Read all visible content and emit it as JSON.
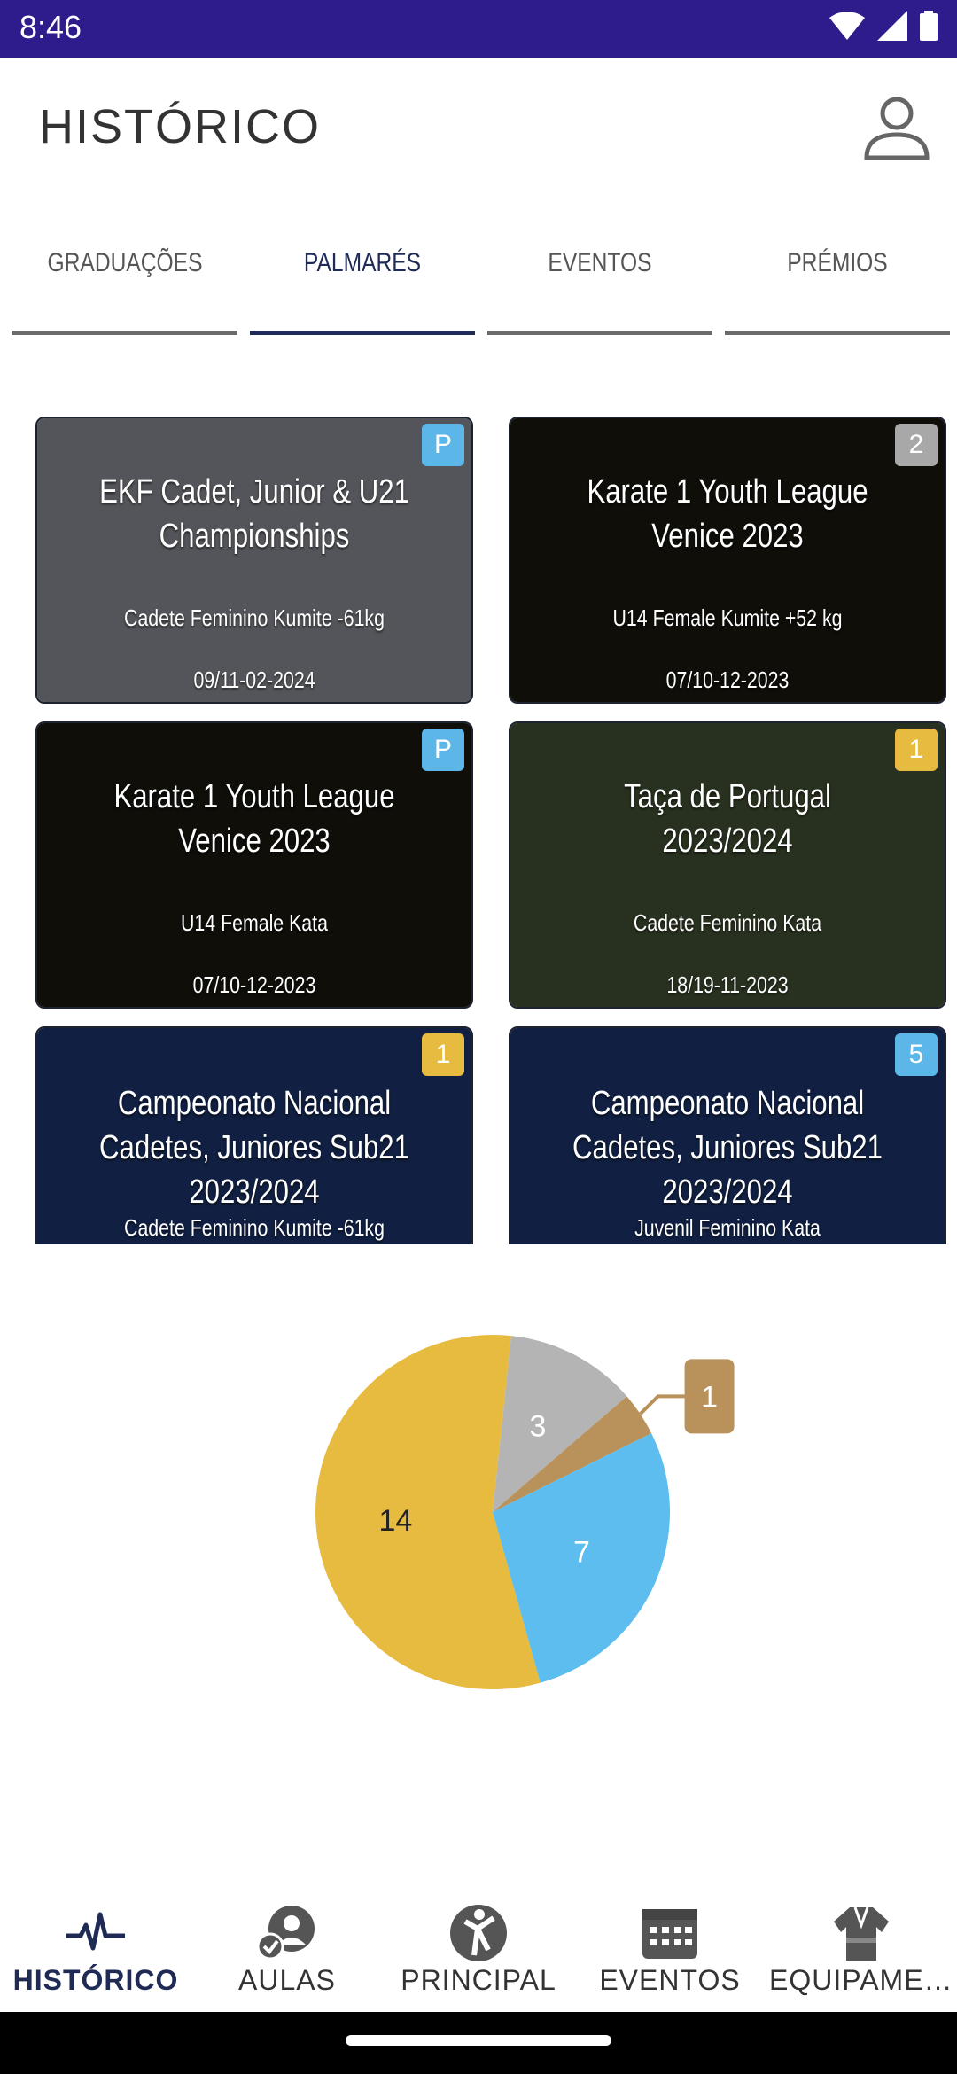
{
  "status_bar": {
    "time": "8:46"
  },
  "app_bar": {
    "title": "HISTÓRICO"
  },
  "tabs": [
    {
      "label": "GRADUAÇÕES",
      "active": false
    },
    {
      "label": "PALMARÉS",
      "active": true
    },
    {
      "label": "EVENTOS",
      "active": false
    },
    {
      "label": "PRÉMIOS",
      "active": false
    }
  ],
  "cards": [
    {
      "title": "EKF Cadet, Junior & U21 Championships",
      "category": "Cadete Feminino Kumite -61kg",
      "date": "09/11-02-2024",
      "badge": "P",
      "badge_color": "#5cb7e8",
      "bg": "#9a9ca4"
    },
    {
      "title": "Karate 1 Youth League Venice 2023",
      "category": "U14 Female Kumite +52 kg",
      "date": "07/10-12-2023",
      "badge": "2",
      "badge_color": "#a8a8a8",
      "bg": "#1c1a12"
    },
    {
      "title": "Karate 1 Youth League Venice 2023",
      "category": "U14 Female Kata",
      "date": "07/10-12-2023",
      "badge": "P",
      "badge_color": "#5cb7e8",
      "bg": "#1c1a12"
    },
    {
      "title": "Taça de Portugal 2023/2024",
      "category": "Cadete Feminino Kata",
      "date": "18/19-11-2023",
      "badge": "1",
      "badge_color": "#e7bb3f",
      "bg": "#4a5a3a"
    },
    {
      "title": "Campeonato Nacional Cadetes, Juniores  Sub21 2023/2024",
      "category": "Cadete Feminino Kumite -61kg",
      "date": "",
      "badge": "1",
      "badge_color": "#e7bb3f",
      "bg": "#1f3b78"
    },
    {
      "title": "Campeonato Nacional Cadetes, Juniores  Sub21 2023/2024",
      "category": "Juvenil Feminino Kata",
      "date": "",
      "badge": "5",
      "badge_color": "#5cb7e8",
      "bg": "#1f3b78"
    }
  ],
  "chart_data": {
    "type": "pie",
    "slices": [
      {
        "label": "14",
        "value": 14,
        "color": "#e7bb3f"
      },
      {
        "label": "3",
        "value": 3,
        "color": "#b4b4b4"
      },
      {
        "label": "1",
        "value": 1,
        "color": "#b8925a"
      },
      {
        "label": "7",
        "value": 7,
        "color": "#5cbdee"
      }
    ]
  },
  "bottom_nav": [
    {
      "label": "HISTÓRICO",
      "icon": "pulse-icon",
      "active": true
    },
    {
      "label": "AULAS",
      "icon": "classes-icon",
      "active": false
    },
    {
      "label": "PRINCIPAL",
      "icon": "karate-icon",
      "active": false
    },
    {
      "label": "EVENTOS",
      "icon": "calendar-icon",
      "active": false
    },
    {
      "label": "EQUIPAMENTOS",
      "icon": "kimono-icon",
      "active": false
    }
  ]
}
